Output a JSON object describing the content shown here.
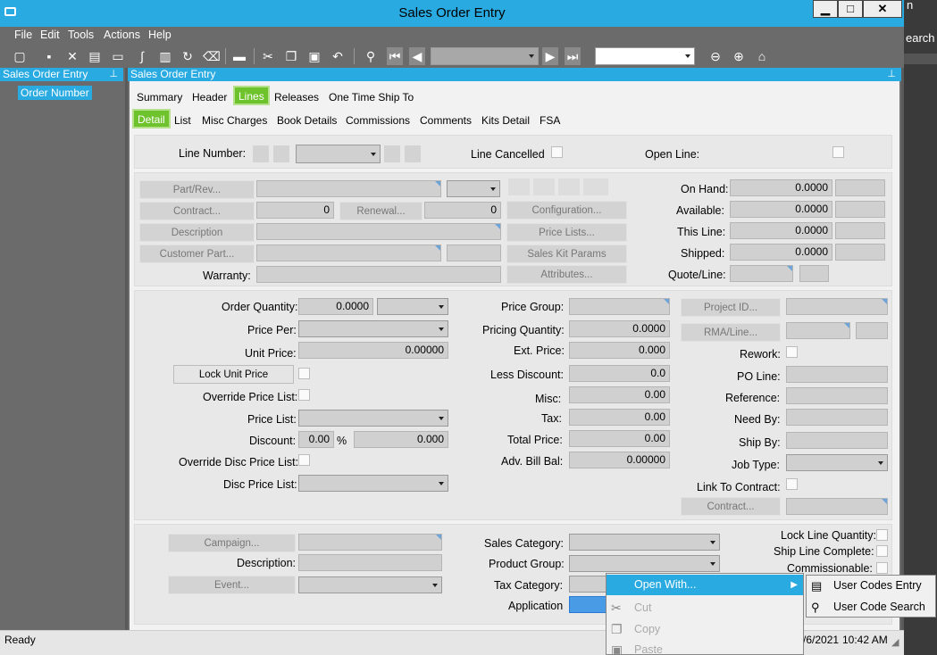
{
  "window": {
    "title": "Sales Order Entry",
    "minimize": "▁",
    "maximize": "□",
    "close": "✕"
  },
  "behind": {
    "text1": "n",
    "text2": "earch"
  },
  "menu": [
    "File",
    "Edit",
    "Tools",
    "Actions",
    "Help"
  ],
  "tree": {
    "header": "Sales Order Entry",
    "item": "Order Number"
  },
  "main": {
    "header": "Sales Order Entry"
  },
  "tabs1": [
    "Summary",
    "Header",
    "Lines",
    "Releases",
    "One Time Ship To"
  ],
  "tabs2": [
    "Detail",
    "List",
    "Misc Charges",
    "Book Details",
    "Commissions",
    "Comments",
    "Kits Detail",
    "FSA"
  ],
  "line": {
    "line_number": "Line Number:",
    "line_cancelled": "Line Cancelled",
    "open_line": "Open Line:"
  },
  "part": {
    "part_rev": "Part/Rev...",
    "contract": "Contract...",
    "contract_val": "0",
    "renewal": "Renewal...",
    "renewal_val": "0",
    "description": "Description",
    "customer_part": "Customer Part...",
    "warranty": "Warranty:",
    "configuration": "Configuration...",
    "price_lists": "Price Lists...",
    "sales_kit_params": "Sales Kit Params",
    "attributes": "Attributes..."
  },
  "qty": {
    "on_hand": "On Hand:",
    "on_hand_val": "0.0000",
    "available": "Available:",
    "available_val": "0.0000",
    "this_line": "This Line:",
    "this_line_val": "0.0000",
    "shipped": "Shipped:",
    "shipped_val": "0.0000",
    "quote_line": "Quote/Line:"
  },
  "pricing": {
    "order_quantity": "Order Quantity:",
    "order_quantity_val": "0.0000",
    "price_per": "Price Per:",
    "unit_price": "Unit Price:",
    "unit_price_val": "0.00000",
    "lock_unit_price": "Lock Unit Price",
    "override_price_list": "Override Price List:",
    "price_list": "Price List:",
    "discount": "Discount:",
    "discount_pct": "0.00",
    "pct_sign": "%",
    "discount_val": "0.000",
    "override_disc_price_list": "Override Disc Price List:",
    "disc_price_list": "Disc Price List:"
  },
  "totals": {
    "price_group": "Price Group:",
    "pricing_quantity": "Pricing Quantity:",
    "pricing_quantity_val": "0.0000",
    "ext_price": "Ext. Price:",
    "ext_price_val": "0.000",
    "less_discount": "Less Discount:",
    "less_discount_val": "0.0",
    "misc": "Misc:",
    "misc_val": "0.00",
    "tax": "Tax:",
    "tax_val": "0.00",
    "total_price": "Total Price:",
    "total_price_val": "0.00",
    "adv_bill_bal": "Adv. Bill Bal:",
    "adv_bill_bal_val": "0.00000"
  },
  "project": {
    "project_id": "Project ID...",
    "rma_line": "RMA/Line...",
    "rework": "Rework:",
    "po_line": "PO Line:",
    "reference": "Reference:",
    "need_by": "Need By:",
    "ship_by": "Ship By:",
    "job_type": "Job Type:",
    "link_to_contract": "Link To Contract:",
    "contract": "Contract..."
  },
  "bottom": {
    "campaign": "Campaign...",
    "description": "Description:",
    "event": "Event...",
    "sales_category": "Sales Category:",
    "product_group": "Product Group:",
    "tax_category": "Tax Category:",
    "application": "Application",
    "lock_line_quantity": "Lock Line Quantity:",
    "ship_line_complete": "Ship Line Complete:",
    "commissionable": "Commissionable:"
  },
  "status": {
    "text": "Ready",
    "date": "/6/2021",
    "time": "10:42 AM"
  },
  "context_menu": {
    "open_with": "Open With...",
    "cut": "Cut",
    "copy": "Copy",
    "paste": "Paste"
  },
  "submenu": {
    "user_codes_entry": "User Codes Entry",
    "user_code_search": "User Code Search"
  }
}
